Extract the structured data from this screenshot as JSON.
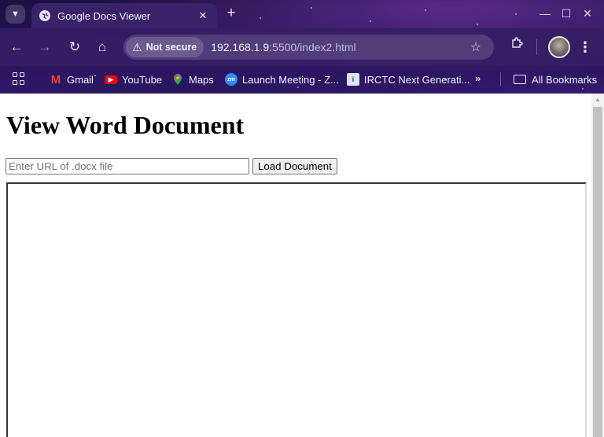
{
  "browser": {
    "tab": {
      "title": "Google Docs Viewer",
      "favicon": "globe-icon",
      "close_glyph": "✕"
    },
    "new_tab_glyph": "+",
    "window_controls": {
      "minimize": "—",
      "maximize": "☐",
      "close": "✕"
    },
    "nav": {
      "back": "←",
      "forward": "→",
      "reload": "↻",
      "home": "⌂"
    },
    "address_bar": {
      "security_label": "Not secure",
      "security_icon": "warning-icon",
      "url_host": "192.168.1.9",
      "url_rest": ":5500/index2.html"
    },
    "bookmarks": [
      {
        "label": "Gmail",
        "icon": "gmail-icon"
      },
      {
        "label": "YouTube",
        "icon": "youtube-icon"
      },
      {
        "label": "Maps",
        "icon": "maps-icon"
      },
      {
        "label": "Launch Meeting - Z...",
        "icon": "zoom-icon"
      },
      {
        "label": "IRCTC Next Generati...",
        "icon": "irctc-icon"
      }
    ],
    "bookmarks_more": "»",
    "all_bookmarks": "All Bookmarks",
    "menu_glyph": "⋮",
    "star_glyph": "☆"
  },
  "page": {
    "heading": "View Word Document",
    "input_placeholder": "Enter URL of .docx file",
    "input_value": "",
    "load_button": "Load Document"
  },
  "colors": {
    "chrome_dark": "#1d1040",
    "chrome_accent": "#5a2a8a",
    "gmail": "#ea4335",
    "youtube": "#ff0000",
    "zoom": "#2d8cff"
  }
}
